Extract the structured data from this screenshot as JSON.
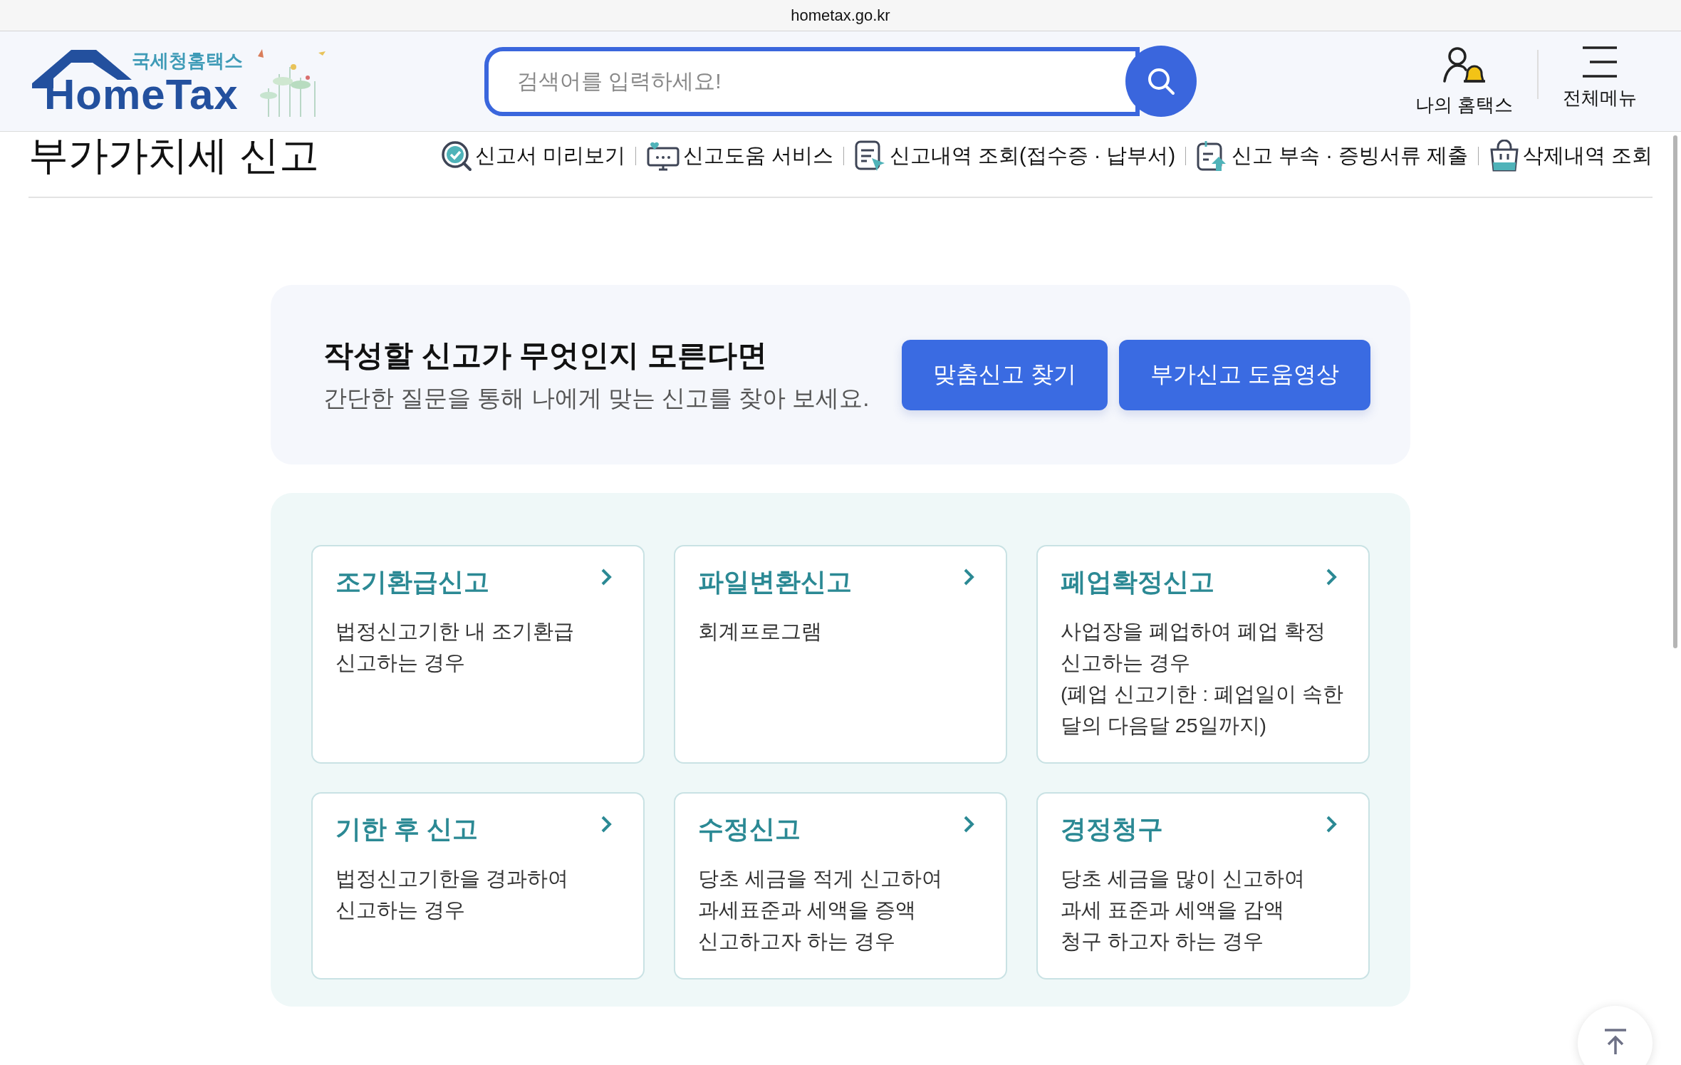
{
  "browser": {
    "address": "hometax.go.kr"
  },
  "header": {
    "logo_subtitle": "국세청홈택스",
    "logo_title": "HomeTax",
    "search": {
      "placeholder": "검색어를 입력하세요!"
    },
    "actions": [
      {
        "kind": "my",
        "label": "나의 홈택스"
      },
      {
        "kind": "menu",
        "label": "전체메뉴"
      }
    ]
  },
  "page": {
    "title": "부가가치세 신고",
    "links": [
      {
        "kind": "preview",
        "label": "신고서 미리보기"
      },
      {
        "kind": "help",
        "label": "신고도움 서비스"
      },
      {
        "kind": "history",
        "label": "신고내역 조회(접수증 · 납부서)"
      },
      {
        "kind": "upload",
        "label": "신고 부속 · 증빙서류 제출"
      },
      {
        "kind": "deleted",
        "label": "삭제내역 조회"
      }
    ]
  },
  "banner": {
    "heading": "작성할 신고가 무엇인지 모른다면",
    "text": "간단한 질문을 통해 나에게 맞는 신고를 찾아 보세요.",
    "buttons": [
      "맞춤신고 찾기",
      "부가신고 도움영상"
    ]
  },
  "cards": [
    {
      "title": "조기환급신고",
      "description": "법정신고기한 내 조기환급\n신고하는 경우"
    },
    {
      "title": "파일변환신고",
      "description": "회계프로그램"
    },
    {
      "title": "폐업확정신고",
      "description": "사업장을 폐업하여 폐업 확정\n신고하는 경우\n(폐업 신고기한 : 폐업일이 속한\n달의 다음달 25일까지)"
    },
    {
      "title": "기한 후 신고",
      "description": "법정신고기한을 경과하여\n신고하는 경우"
    },
    {
      "title": "수정신고",
      "description": "당초 세금을 적게 신고하여\n과세표준과 세액을 증액\n신고하고자 하는 경우"
    },
    {
      "title": "경정청구",
      "description": "당초 세금을 많이 신고하여\n과세 표준과 세액을 감액\n청구 하고자 하는 경우"
    }
  ]
}
